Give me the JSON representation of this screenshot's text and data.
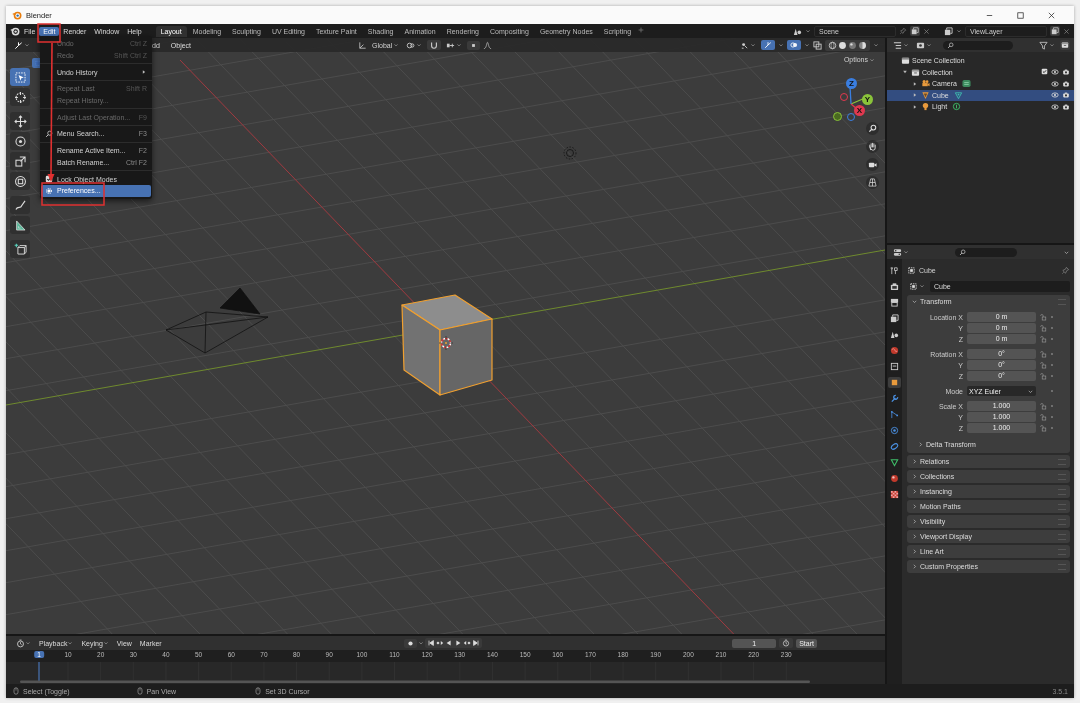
{
  "window": {
    "title": "Blender"
  },
  "top_menu": [
    {
      "label": "File",
      "selected": false
    },
    {
      "label": "Edit",
      "selected": true
    },
    {
      "label": "Render",
      "selected": false
    },
    {
      "label": "Window",
      "selected": false
    },
    {
      "label": "Help",
      "selected": false
    }
  ],
  "workspaces": [
    {
      "label": "Layout",
      "selected": true
    },
    {
      "label": "Modeling",
      "selected": false
    },
    {
      "label": "Sculpting",
      "selected": false
    },
    {
      "label": "UV Editing",
      "selected": false
    },
    {
      "label": "Texture Paint",
      "selected": false
    },
    {
      "label": "Shading",
      "selected": false
    },
    {
      "label": "Animation",
      "selected": false
    },
    {
      "label": "Rendering",
      "selected": false
    },
    {
      "label": "Compositing",
      "selected": false
    },
    {
      "label": "Geometry Nodes",
      "selected": false
    },
    {
      "label": "Scripting",
      "selected": false
    }
  ],
  "scene": "Scene",
  "view_layer": "ViewLayer",
  "viewport": {
    "header_menus": [
      "dd",
      "Object"
    ],
    "orientation": "Global",
    "options": "Options",
    "gizmo_axes": [
      "X",
      "Y",
      "Z"
    ]
  },
  "tools": [
    {
      "kind": "select",
      "selected": true
    },
    {
      "kind": "cursor",
      "selected": false
    },
    {
      "kind": "move",
      "selected": false
    },
    {
      "kind": "rotate",
      "selected": false
    },
    {
      "kind": "scale",
      "selected": false
    },
    {
      "kind": "transform",
      "selected": false
    },
    {
      "kind": "annotate",
      "selected": false
    },
    {
      "kind": "measure",
      "selected": false
    },
    {
      "kind": "add_cube",
      "selected": false
    }
  ],
  "edit_menu": {
    "items": [
      {
        "kind": "item",
        "label": "Undo",
        "shortcut": "Ctrl Z",
        "disabled": true,
        "selected": false
      },
      {
        "kind": "item",
        "label": "Redo",
        "shortcut": "Shift Ctrl Z",
        "disabled": true,
        "selected": false
      },
      {
        "kind": "separator"
      },
      {
        "kind": "submenu",
        "label": "Undo History",
        "disabled": false,
        "selected": false
      },
      {
        "kind": "separator"
      },
      {
        "kind": "item",
        "label": "Repeat Last",
        "shortcut": "Shift R",
        "disabled": true,
        "selected": false
      },
      {
        "kind": "item",
        "label": "Repeat History...",
        "disabled": true,
        "selected": false
      },
      {
        "kind": "separator"
      },
      {
        "kind": "item",
        "label": "Adjust Last Operation...",
        "shortcut": "F9",
        "disabled": true,
        "selected": false
      },
      {
        "kind": "separator"
      },
      {
        "kind": "search",
        "label": "Menu Search...",
        "shortcut": "F3",
        "disabled": false,
        "selected": false
      },
      {
        "kind": "separator"
      },
      {
        "kind": "item",
        "label": "Rename Active Item...",
        "shortcut": "F2",
        "disabled": false,
        "selected": false
      },
      {
        "kind": "item",
        "label": "Batch Rename...",
        "shortcut": "Ctrl F2",
        "disabled": false,
        "selected": false
      },
      {
        "kind": "separator"
      },
      {
        "kind": "checkbox",
        "label": "Lock Object Modes",
        "checked": true,
        "disabled": false,
        "selected": false
      },
      {
        "kind": "settings",
        "label": "Preferences...",
        "disabled": false,
        "selected": true
      }
    ]
  },
  "outliner": {
    "items": [
      {
        "kind": "scene_collection",
        "label": "Scene Collection",
        "selected": false,
        "children": [
          {
            "kind": "collection",
            "label": "Collection",
            "expanded": true,
            "checked": true,
            "selected": false,
            "children": [
              {
                "kind": "camera",
                "label": "Camera",
                "expanded": false,
                "selected": false
              },
              {
                "kind": "mesh",
                "label": "Cube",
                "expanded": false,
                "selected": true
              },
              {
                "kind": "light",
                "label": "Light",
                "expanded": false,
                "selected": false
              }
            ]
          }
        ]
      }
    ]
  },
  "properties": {
    "tabs": [
      {
        "kind": "tool",
        "selected": false
      },
      {
        "kind": "render",
        "selected": false
      },
      {
        "kind": "output",
        "selected": false
      },
      {
        "kind": "view_layer",
        "selected": false
      },
      {
        "kind": "scene",
        "selected": false
      },
      {
        "kind": "world",
        "selected": false
      },
      {
        "kind": "collection",
        "selected": false
      },
      {
        "kind": "object",
        "selected": true
      },
      {
        "kind": "modifiers",
        "selected": false
      },
      {
        "kind": "particles",
        "selected": false
      },
      {
        "kind": "physics",
        "selected": false
      },
      {
        "kind": "constraints",
        "selected": false
      },
      {
        "kind": "data",
        "selected": false
      },
      {
        "kind": "material",
        "selected": false
      },
      {
        "kind": "texture",
        "selected": false
      }
    ],
    "object": "Cube",
    "name_field": "Cube",
    "panels": [
      {
        "title": "Transform",
        "expanded": true,
        "rows": [
          {
            "kind": "number",
            "label": "Location X",
            "value": "0 m"
          },
          {
            "kind": "number",
            "label": "Y",
            "value": "0 m"
          },
          {
            "kind": "number",
            "label": "Z",
            "value": "0 m"
          },
          {
            "kind": "number",
            "label": "Rotation X",
            "value": "0°"
          },
          {
            "kind": "number",
            "label": "Y",
            "value": "0°"
          },
          {
            "kind": "number",
            "label": "Z",
            "value": "0°"
          },
          {
            "kind": "dropdown",
            "label": "Mode",
            "value": "XYZ Euler"
          },
          {
            "kind": "number",
            "label": "Scale X",
            "value": "1.000"
          },
          {
            "kind": "number",
            "label": "Y",
            "value": "1.000"
          },
          {
            "kind": "number",
            "label": "Z",
            "value": "1.000"
          }
        ],
        "subpanels": [
          {
            "title": "Delta Transform",
            "expanded": false
          }
        ]
      },
      {
        "title": "Relations",
        "expanded": false
      },
      {
        "title": "Collections",
        "expanded": false
      },
      {
        "title": "Instancing",
        "expanded": false
      },
      {
        "title": "Motion Paths",
        "expanded": false
      },
      {
        "title": "Visibility",
        "expanded": false
      },
      {
        "title": "Viewport Display",
        "expanded": false
      },
      {
        "title": "Line Art",
        "expanded": false
      },
      {
        "title": "Custom Properties",
        "expanded": false
      }
    ]
  },
  "timeline": {
    "menus": [
      "Playback",
      "Keying",
      "View",
      "Marker"
    ],
    "current_frame": "1",
    "start_label": "Start",
    "ruler": [
      {
        "label": "1",
        "selected": true
      },
      {
        "label": "10",
        "selected": false
      },
      {
        "label": "20",
        "selected": false
      },
      {
        "label": "30",
        "selected": false
      },
      {
        "label": "40",
        "selected": false
      },
      {
        "label": "50",
        "selected": false
      },
      {
        "label": "60",
        "selected": false
      },
      {
        "label": "70",
        "selected": false
      },
      {
        "label": "80",
        "selected": false
      },
      {
        "label": "90",
        "selected": false
      },
      {
        "label": "100",
        "selected": false
      },
      {
        "label": "110",
        "selected": false
      },
      {
        "label": "120",
        "selected": false
      },
      {
        "label": "130",
        "selected": false
      },
      {
        "label": "140",
        "selected": false
      },
      {
        "label": "150",
        "selected": false
      },
      {
        "label": "160",
        "selected": false
      },
      {
        "label": "170",
        "selected": false
      },
      {
        "label": "180",
        "selected": false
      },
      {
        "label": "190",
        "selected": false
      },
      {
        "label": "200",
        "selected": false
      },
      {
        "label": "210",
        "selected": false
      },
      {
        "label": "220",
        "selected": false
      },
      {
        "label": "230",
        "selected": false
      }
    ]
  },
  "status_bar": {
    "hints": [
      "Select (Toggle)",
      "Pan View",
      "Set 3D Cursor"
    ],
    "version": "3.5.1"
  }
}
